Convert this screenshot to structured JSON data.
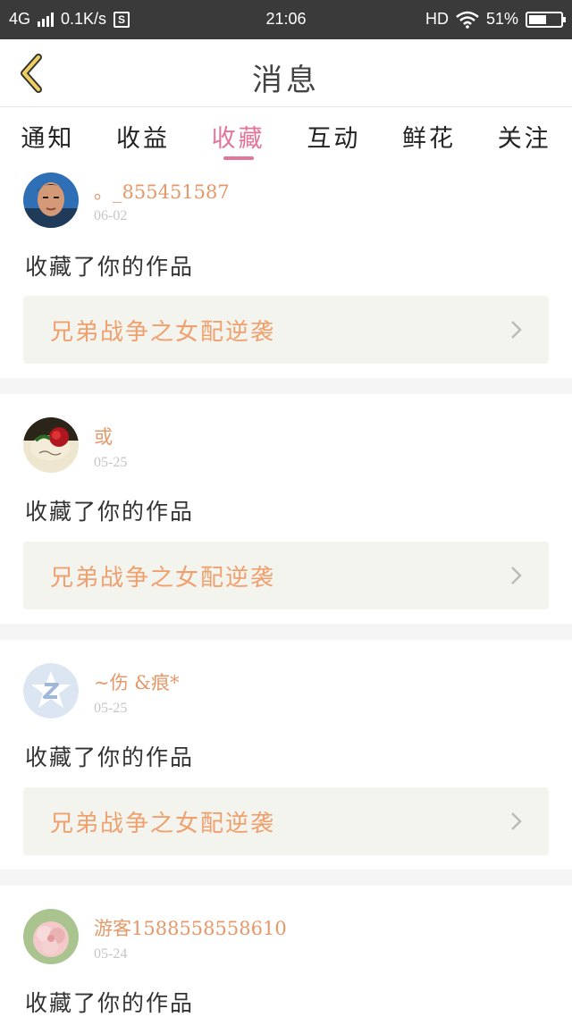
{
  "status_bar": {
    "network": "4G",
    "speed": "0.1K/s",
    "s_badge": "S",
    "time": "21:06",
    "hd": "HD",
    "battery": "51%"
  },
  "header": {
    "title": "消息",
    "back_icon": "chevron-left-icon",
    "accent": "#e5749b"
  },
  "tabs": [
    {
      "label": "通知",
      "active": false
    },
    {
      "label": "收益",
      "active": false
    },
    {
      "label": "收藏",
      "active": true
    },
    {
      "label": "互动",
      "active": false
    },
    {
      "label": "鲜花",
      "active": false
    },
    {
      "label": "关注",
      "active": false
    }
  ],
  "items": [
    {
      "username": "。_855451587",
      "date": "06-02",
      "action": "收藏了你的作品",
      "work_title": "兄弟战争之女配逆袭"
    },
    {
      "username": "或",
      "date": "05-25",
      "action": "收藏了你的作品",
      "work_title": "兄弟战争之女配逆袭"
    },
    {
      "username": "~伤 &痕*",
      "date": "05-25",
      "action": "收藏了你的作品",
      "work_title": "兄弟战争之女配逆袭"
    },
    {
      "username": "游客1588558558610",
      "date": "05-24",
      "action": "收藏了你的作品"
    }
  ]
}
